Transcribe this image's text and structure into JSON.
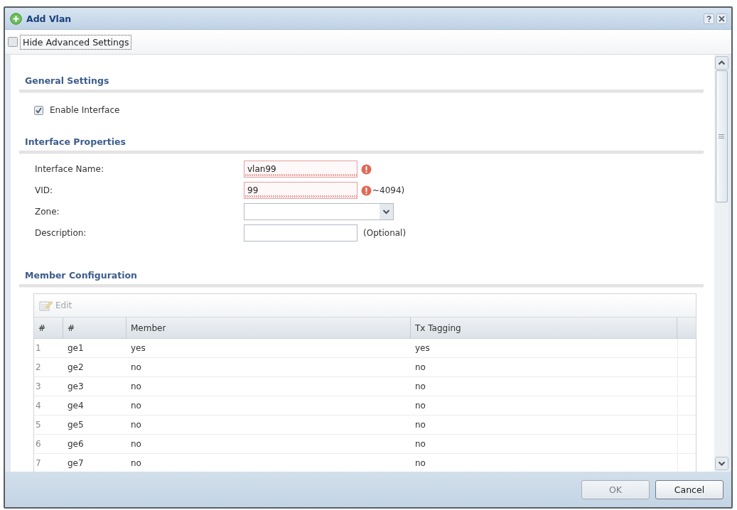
{
  "window": {
    "title": "Add Vlan"
  },
  "toolbar": [
    {
      "label": "Hide Advanced Settings",
      "focused": true
    }
  ],
  "sections": [
    {
      "kind": "checks",
      "title": "General Settings",
      "items": [
        {
          "label": "Enable Interface",
          "checked": true
        }
      ]
    },
    {
      "kind": "form",
      "title": "Interface Properties",
      "fields": [
        {
          "kind": "text",
          "label": "Interface Name:",
          "value": "vlan99",
          "error": true
        },
        {
          "kind": "text",
          "label": "VID:",
          "value": "99",
          "error": true,
          "hint": "~4094)"
        },
        {
          "kind": "select",
          "label": "Zone:"
        },
        {
          "kind": "text",
          "label": "Description:",
          "error": false,
          "hint": "(Optional)"
        }
      ]
    },
    {
      "kind": "table",
      "title": "Member Configuration",
      "toolbar": [
        {
          "label": "Edit",
          "disabled": true
        }
      ],
      "columns": [
        "#",
        "#",
        "Member",
        "Tx Tagging"
      ],
      "rows": [
        [
          "1",
          "ge1",
          "yes",
          "yes"
        ],
        [
          "2",
          "ge2",
          "no",
          "no"
        ],
        [
          "3",
          "ge3",
          "no",
          "no"
        ],
        [
          "4",
          "ge4",
          "no",
          "no"
        ],
        [
          "5",
          "ge5",
          "no",
          "no"
        ],
        [
          "6",
          "ge6",
          "no",
          "no"
        ],
        [
          "7",
          "ge7",
          "no",
          "no"
        ]
      ]
    }
  ],
  "buttons": [
    {
      "label": "OK",
      "disabled": true
    },
    {
      "label": "Cancel",
      "disabled": false
    }
  ]
}
